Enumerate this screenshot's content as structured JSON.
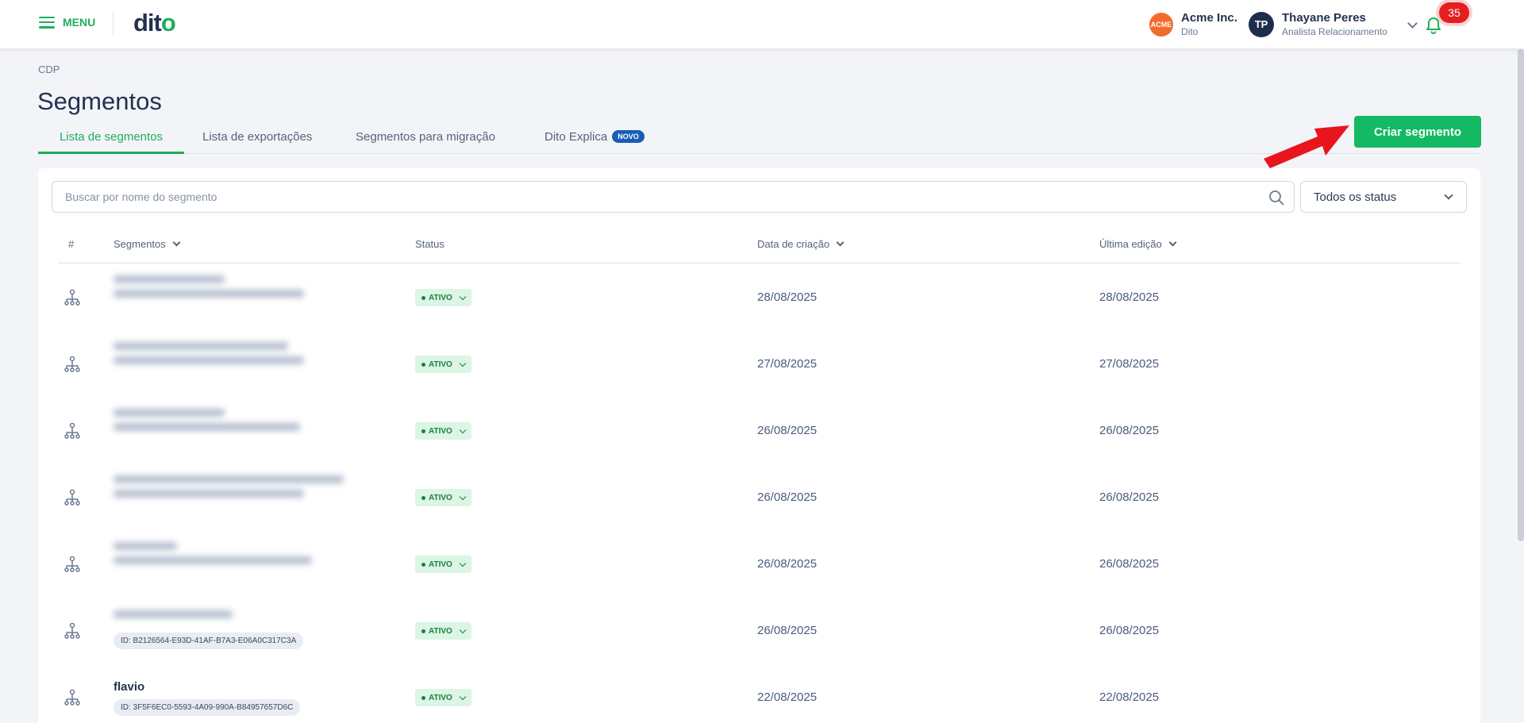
{
  "header": {
    "menu_label": "MENU",
    "logo_text": "dito",
    "org_badge": "ACME",
    "org_name": "Acme Inc.",
    "org_sub": "Dito",
    "user_initials": "TP",
    "user_name": "Thayane Peres",
    "user_role": "Analista Relacionamento",
    "notifications": "35"
  },
  "breadcrumb": "CDP",
  "page_title": "Segmentos",
  "tabs": [
    {
      "label": "Lista de segmentos"
    },
    {
      "label": "Lista de exportações"
    },
    {
      "label": "Segmentos para migração"
    },
    {
      "label": "Dito Explica",
      "badge": "NOVO"
    }
  ],
  "create_button": "Criar segmento",
  "search": {
    "placeholder": "Buscar por nome do segmento"
  },
  "status_filter": "Todos os status",
  "columns": {
    "index": "#",
    "segments": "Segmentos",
    "status": "Status",
    "created": "Data de criação",
    "edited": "Última edição"
  },
  "rows": [
    {
      "status": "ATIVO",
      "created": "28/08/2025",
      "edited": "28/08/2025"
    },
    {
      "status": "ATIVO",
      "created": "27/08/2025",
      "edited": "27/08/2025"
    },
    {
      "status": "ATIVO",
      "created": "26/08/2025",
      "edited": "26/08/2025"
    },
    {
      "status": "ATIVO",
      "created": "26/08/2025",
      "edited": "26/08/2025"
    },
    {
      "status": "ATIVO",
      "created": "26/08/2025",
      "edited": "26/08/2025"
    },
    {
      "id": "ID: B2126564-E93D-41AF-B7A3-E06A0C317C3A",
      "status": "ATIVO",
      "created": "26/08/2025",
      "edited": "26/08/2025"
    },
    {
      "name": "flavio",
      "id": "ID: 3F5F6EC0-5593-4A09-990A-B84957657D6C",
      "status": "ATIVO",
      "created": "22/08/2025",
      "edited": "22/08/2025"
    }
  ],
  "colors": {
    "accent": "#14b964",
    "alert": "#e41f1f",
    "navy": "#24324f"
  }
}
